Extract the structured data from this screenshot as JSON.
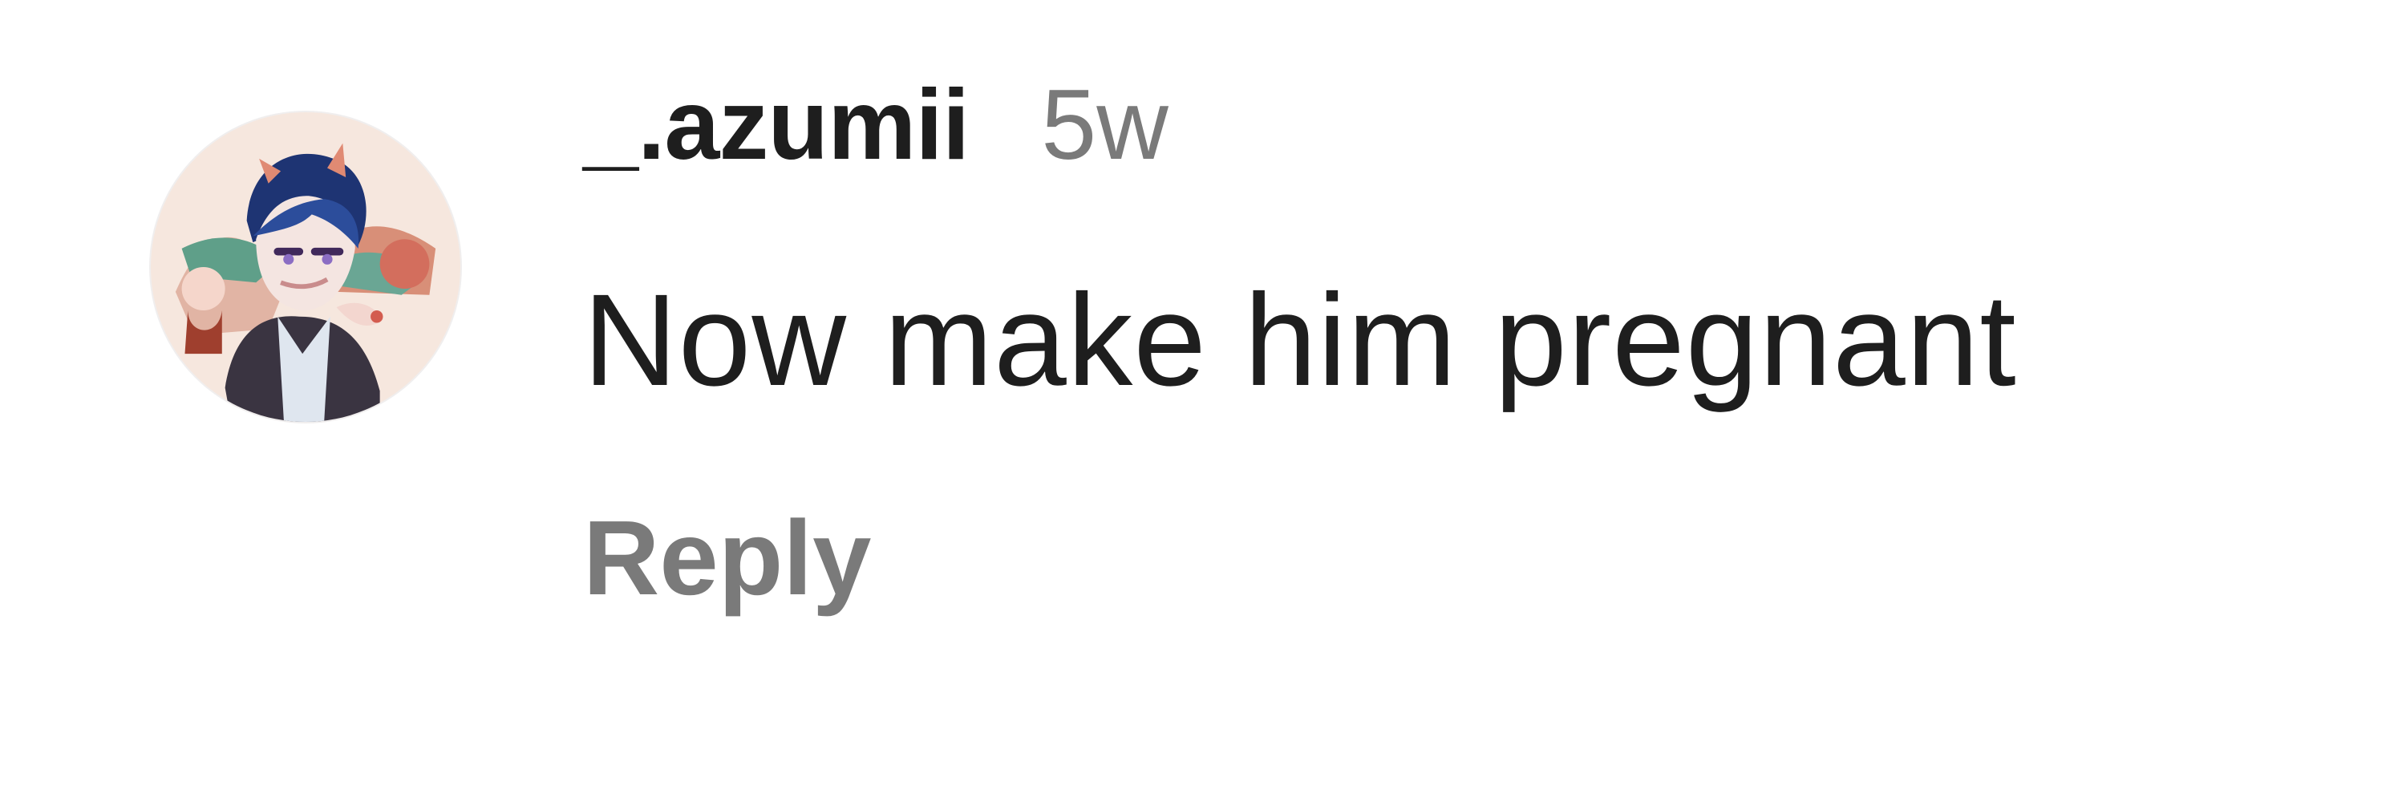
{
  "comment": {
    "username": "_.azumii",
    "timestamp": "5w",
    "text": "Now make him pregnant",
    "reply_label": "Reply",
    "avatar_icon": "profile-avatar-icon"
  },
  "colors": {
    "background": "#ffffff",
    "primary_text": "#1e1e1e",
    "secondary_text": "#7a7a7a"
  }
}
